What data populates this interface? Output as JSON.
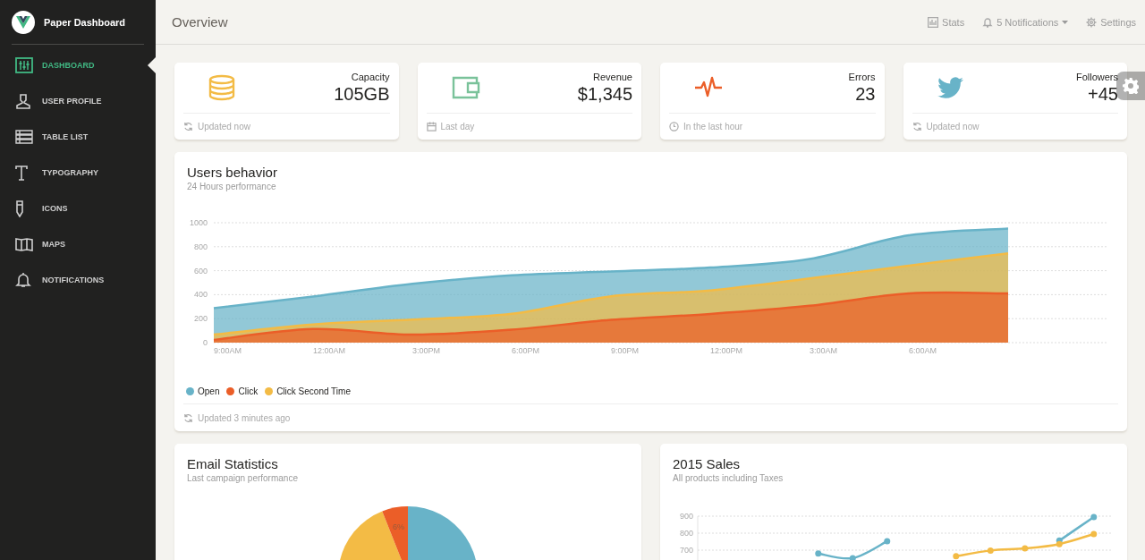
{
  "sidebar": {
    "brand": "Paper Dashboard",
    "items": [
      {
        "label": "DASHBOARD",
        "kind": "sliders",
        "selected": true
      },
      {
        "label": "USER PROFILE",
        "kind": "user",
        "selected": false
      },
      {
        "label": "TABLE LIST",
        "kind": "list",
        "selected": false
      },
      {
        "label": "TYPOGRAPHY",
        "kind": "type",
        "selected": false
      },
      {
        "label": "ICONS",
        "kind": "pencil",
        "selected": false
      },
      {
        "label": "MAPS",
        "kind": "map",
        "selected": false
      },
      {
        "label": "NOTIFICATIONS",
        "kind": "bell",
        "selected": false
      }
    ]
  },
  "navbar": {
    "title": "Overview",
    "links": [
      {
        "label": "Stats",
        "kind": "stats"
      },
      {
        "label": "5 Notifications",
        "kind": "notifications"
      },
      {
        "label": "Settings",
        "kind": "settings"
      }
    ]
  },
  "stats": [
    {
      "kind": "database",
      "label": "Capacity",
      "value": "105GB",
      "footer": {
        "text": "Updated now",
        "kind": "reload"
      },
      "color": "#f3bb45"
    },
    {
      "kind": "wallet",
      "label": "Revenue",
      "value": "$1,345",
      "footer": {
        "text": "Last day",
        "kind": "calendar"
      },
      "color": "#7ac29a"
    },
    {
      "kind": "pulse",
      "label": "Errors",
      "value": "23",
      "footer": {
        "text": "In the last hour",
        "kind": "clock"
      },
      "color": "#eb5e28"
    },
    {
      "kind": "bird",
      "label": "Followers",
      "value": "+45",
      "footer": {
        "text": "Updated now",
        "kind": "reload"
      },
      "color": "#68b3c8"
    }
  ],
  "users_behavior": {
    "title": "Users behavior",
    "subtitle": "24 Hours performance",
    "footer": "Updated 3 minutes ago",
    "chart_data": {
      "type": "area",
      "categories": [
        "9:00AM",
        "12:00AM",
        "3:00PM",
        "6:00PM",
        "9:00PM",
        "12:00PM",
        "3:00AM",
        "6:00AM",
        null
      ],
      "ylim": [
        0,
        1000
      ],
      "yticks": [
        0,
        200,
        400,
        600,
        800,
        1000
      ],
      "grid": true,
      "series": [
        {
          "name": "Open",
          "color": "#68b3c8",
          "values": [
            287,
            385,
            490,
            562,
            594,
            626,
            698,
            895,
            952
          ]
        },
        {
          "name": "Click",
          "color": "#eb5e28",
          "values": [
            23,
            113,
            67,
            108,
            190,
            239,
            307,
            410,
            410
          ]
        },
        {
          "name": "Click Second Time",
          "color": "#f3bb45",
          "values": [
            67,
            152,
            193,
            240,
            387,
            435,
            535,
            642,
            744
          ]
        }
      ]
    }
  },
  "email_statistics": {
    "title": "Email Statistics",
    "subtitle": "Last campaign performance",
    "chart_data": {
      "type": "pie",
      "values": [
        62,
        32,
        6
      ],
      "colors": [
        "#68b3c8",
        "#f3bb45",
        "#eb5e28"
      ],
      "value_labels": [
        null,
        null,
        "6%"
      ]
    }
  },
  "sales": {
    "title": "2015 Sales",
    "subtitle": "All products including Taxes",
    "chart_data": {
      "type": "line",
      "categories": [
        null,
        null,
        null,
        null,
        null,
        null,
        null,
        null,
        null,
        null,
        null,
        null
      ],
      "ylim": [
        640,
        900
      ],
      "yticks": [
        700,
        800,
        900
      ],
      "grid": true,
      "series": [
        {
          "color": "#68b3c8",
          "marker": true,
          "values": [
            null,
            null,
            null,
            680,
            653,
            753,
            null,
            null,
            null,
            null,
            756,
            895
          ]
        },
        {
          "color": "#f3bb45",
          "marker": true,
          "values": [
            null,
            null,
            null,
            null,
            null,
            null,
            null,
            664,
            698,
            710,
            736,
            795
          ]
        }
      ]
    }
  }
}
